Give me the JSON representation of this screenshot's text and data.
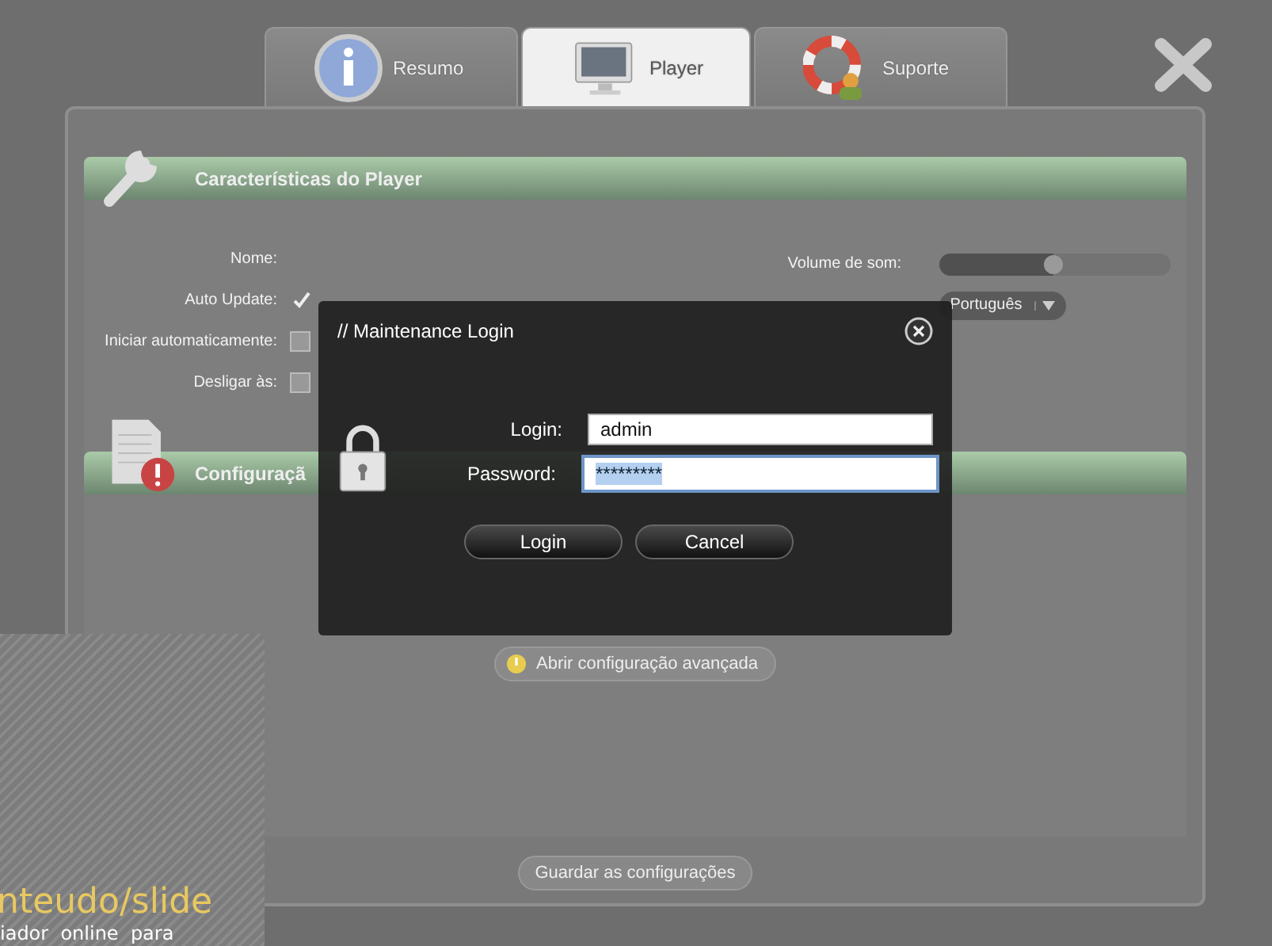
{
  "tabs": [
    {
      "label": "Resumo",
      "selected": false,
      "kind": "info"
    },
    {
      "label": "Player",
      "selected": true,
      "kind": "monitor"
    },
    {
      "label": "Suporte",
      "selected": false,
      "kind": "support"
    }
  ],
  "player_section": {
    "title": "Características do Player",
    "fields": [
      {
        "label": "Nome:",
        "kind": "text"
      },
      {
        "label": "Auto Update:",
        "kind": "checkbox",
        "checked": true
      },
      {
        "label": "Iniciar automaticamente:",
        "kind": "checkbox",
        "checked": false
      },
      {
        "label": "Desligar às:",
        "kind": "checkbox",
        "checked": false
      }
    ],
    "volume": {
      "label": "Volume de som:",
      "level": 0.49
    },
    "language": {
      "value": "Português"
    }
  },
  "advanced_section": {
    "title": "Configuraçã",
    "button": "Abrir configuração avançada"
  },
  "save_button": "Guardar as configurações",
  "background_page": {
    "heading": "nteudo/slide",
    "text": "iador  online  para"
  },
  "dialog": {
    "title": "// Maintenance Login",
    "login_label": "Login:",
    "login_value": "admin",
    "password_label": "Password:",
    "password_value": "*********",
    "buttons": [
      "Login",
      "Cancel"
    ]
  }
}
